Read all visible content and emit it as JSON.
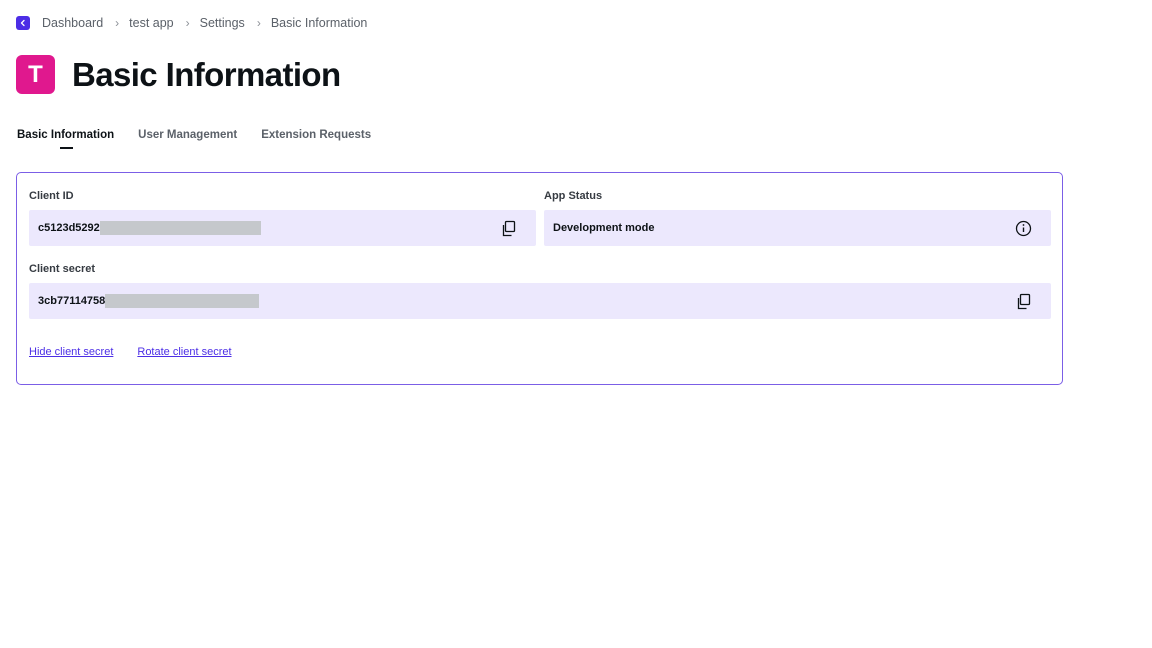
{
  "breadcrumb": {
    "items": [
      "Dashboard",
      "test app",
      "Settings",
      "Basic Information"
    ]
  },
  "header": {
    "avatar_letter": "T",
    "title": "Basic Information"
  },
  "tabs": [
    {
      "label": "Basic Information",
      "active": true
    },
    {
      "label": "User Management",
      "active": false
    },
    {
      "label": "Extension Requests",
      "active": false
    }
  ],
  "card": {
    "client_id": {
      "label": "Client ID",
      "value": "c5123d5292"
    },
    "app_status": {
      "label": "App Status",
      "value": "Development mode"
    },
    "client_secret": {
      "label": "Client secret",
      "value": "3cb77114758"
    },
    "links": {
      "hide_secret": "Hide client secret",
      "rotate_secret": "Rotate client secret"
    }
  },
  "icons": {
    "back": "chevron-left-icon",
    "copy": "copy-icon",
    "info": "info-icon"
  },
  "colors": {
    "accent": "#4c2ee6",
    "avatar": "#e0188e",
    "card_border": "#7b5ee6",
    "field_bg": "#ece8fd"
  }
}
